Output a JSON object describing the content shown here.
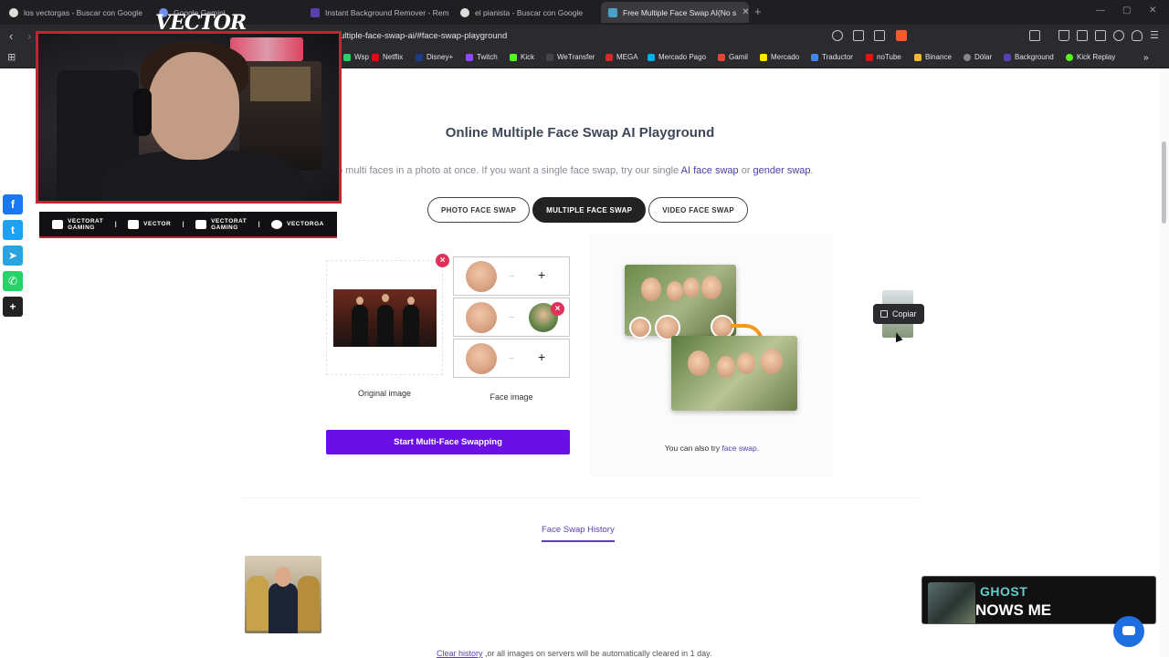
{
  "browser": {
    "tabs": [
      {
        "title": "los vectorgas - Buscar con Google",
        "active": false
      },
      {
        "title": "Google Gemini",
        "active": false
      },
      {
        "title": "Instant Background Remover - Remo",
        "active": false
      },
      {
        "title": "el pianista - Buscar con Google",
        "active": false
      },
      {
        "title": "Free Multiple Face Swap AI(No s",
        "active": true
      }
    ],
    "new_tab": "+",
    "url": "ultiple-face-swap-ai/#face-swap-playground",
    "bookmarks": [
      "Wsp",
      "Netflix",
      "Disney+",
      "Twitch",
      "Kick",
      "WeTransfer",
      "MEGA",
      "Mercado Pago",
      "Gamil",
      "Mercado",
      "Traductor",
      "noTube",
      "Binance",
      "Dólar",
      "Background",
      "Kick Replay"
    ],
    "bookmarks_more": "»"
  },
  "stream": {
    "logo": "VECTOR",
    "social": [
      {
        "line1": "VECTORAT",
        "line2": "GAMING"
      },
      {
        "line1": "VECTOR",
        "line2": ""
      },
      {
        "line1": "VECTORAT",
        "line2": "GAMING"
      },
      {
        "line1": "VECTORGA",
        "line2": ""
      }
    ],
    "social_sep": "I"
  },
  "share": {
    "plus": "+"
  },
  "page": {
    "title": "Online Multiple Face Swap AI Playground",
    "subtitle_pre": "o multi faces in a photo at once. If you want a single face swap, try our single ",
    "subtitle_link1": "AI face swap",
    "subtitle_mid": " or ",
    "subtitle_link2": "gender swap",
    "subtitle_post": ".",
    "mode_tabs": [
      "PHOTO FACE SWAP",
      "MULTIPLE FACE SWAP",
      "VIDEO FACE SWAP"
    ],
    "active_mode": "MULTIPLE FACE SWAP",
    "original_caption": "Original image",
    "face_caption": "Face image",
    "remove_glyph": "×",
    "arrow_glyph": "→",
    "add_glyph": "+",
    "start_button": "Start Multi-Face Swapping",
    "try_text_pre": "You can also try ",
    "try_text_link": "face swap",
    "try_text_post": ".",
    "tooltip_copy": "Copiar",
    "history_tab": "Face Swap History",
    "clear_link": "Clear history",
    "clear_text": " ,or all images on servers will be automatically cleared in 1 day."
  },
  "overlay": {
    "line1": "GHOST",
    "line2": "NOWS ME"
  },
  "colors": {
    "accent": "#6a0fe6",
    "link": "#5a3fb0",
    "remove": "#e0315a",
    "stream_red": "#c4232f"
  }
}
